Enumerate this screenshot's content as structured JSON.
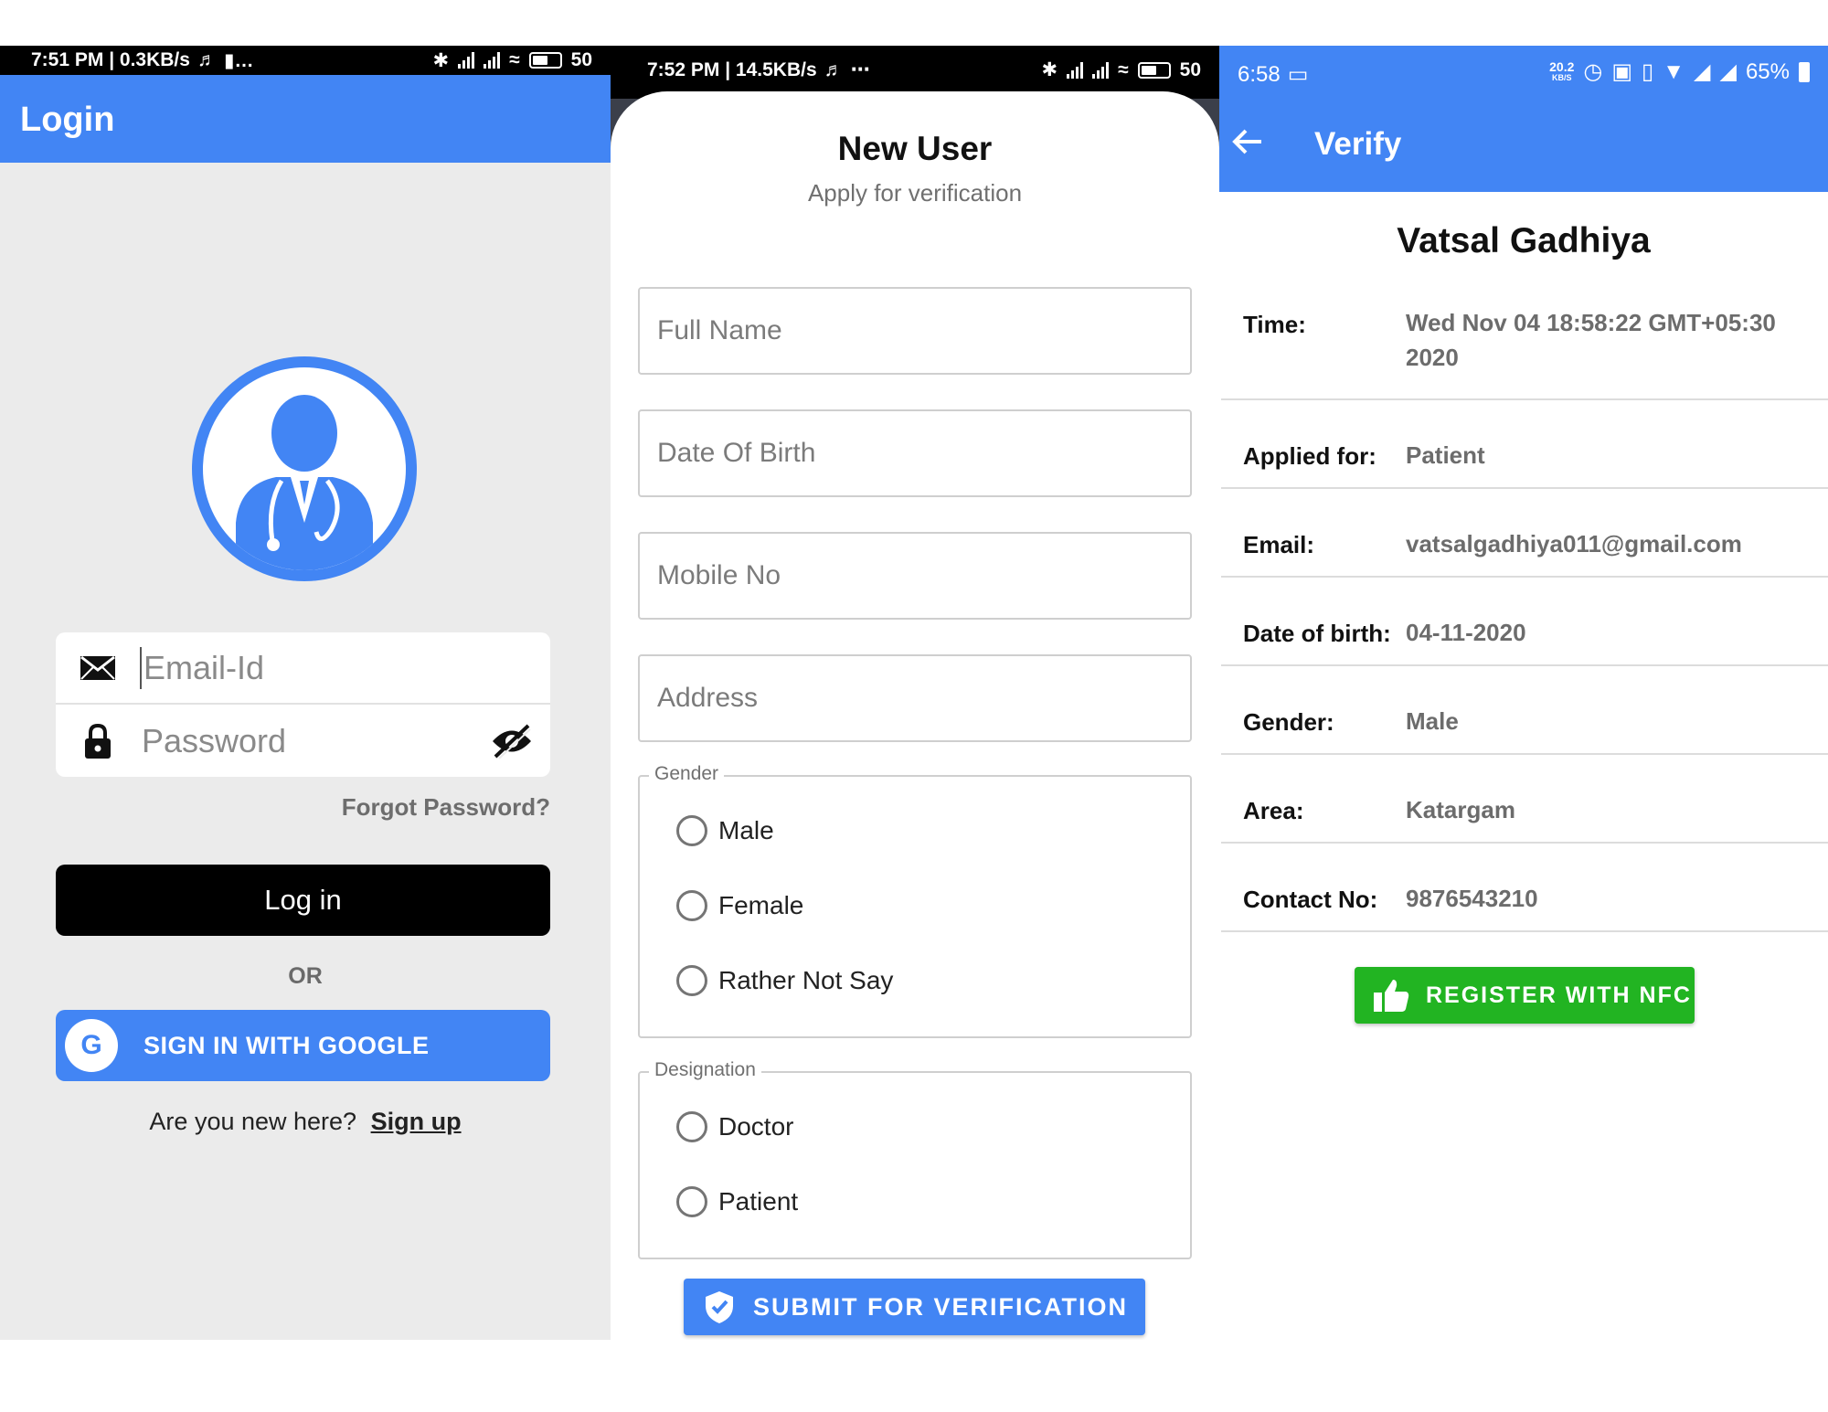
{
  "login": {
    "status": {
      "time": "7:51 PM | 0.3KB/s",
      "battery": "50"
    },
    "title": "Login",
    "email_placeholder": "Email-Id",
    "password_placeholder": "Password",
    "forgot": "Forgot Password?",
    "login_button": "Log in",
    "or": "OR",
    "google_button": "SIGN IN WITH GOOGLE",
    "google_letter": "G",
    "new_here": "Are you new here?",
    "sign_up": "Sign up",
    "accent": "#4285f4"
  },
  "new_user": {
    "status": {
      "time": "7:52 PM | 14.5KB/s",
      "battery": "50"
    },
    "title": "New User",
    "subtitle": "Apply for verification",
    "fields": [
      "Full Name",
      "Date Of Birth",
      "Mobile No",
      "Address"
    ],
    "gender": {
      "legend": "Gender",
      "options": [
        "Male",
        "Female",
        "Rather Not Say"
      ]
    },
    "designation": {
      "legend": "Designation",
      "options": [
        "Doctor",
        "Patient"
      ]
    },
    "submit": "SUBMIT FOR VERIFICATION"
  },
  "verify": {
    "status": {
      "time": "6:58",
      "speed": "20.2",
      "speed_unit": "KB/S",
      "battery": "65%"
    },
    "title": "Verify",
    "name": "Vatsal Gadhiya",
    "rows": [
      {
        "label": "Time:",
        "value": "Wed Nov 04 18:58:22 GMT+05:30 2020"
      },
      {
        "label": "Applied for:",
        "value": "Patient"
      },
      {
        "label": "Email:",
        "value": "vatsalgadhiya011@gmail.com"
      },
      {
        "label": "Date of birth:",
        "value": "04-11-2020"
      },
      {
        "label": "Gender:",
        "value": "Male"
      },
      {
        "label": "Area:",
        "value": "Katargam"
      },
      {
        "label": "Contact No:",
        "value": "9876543210"
      }
    ],
    "nfc_button": "REGISTER WITH NFC",
    "nfc_color": "#22b422"
  }
}
